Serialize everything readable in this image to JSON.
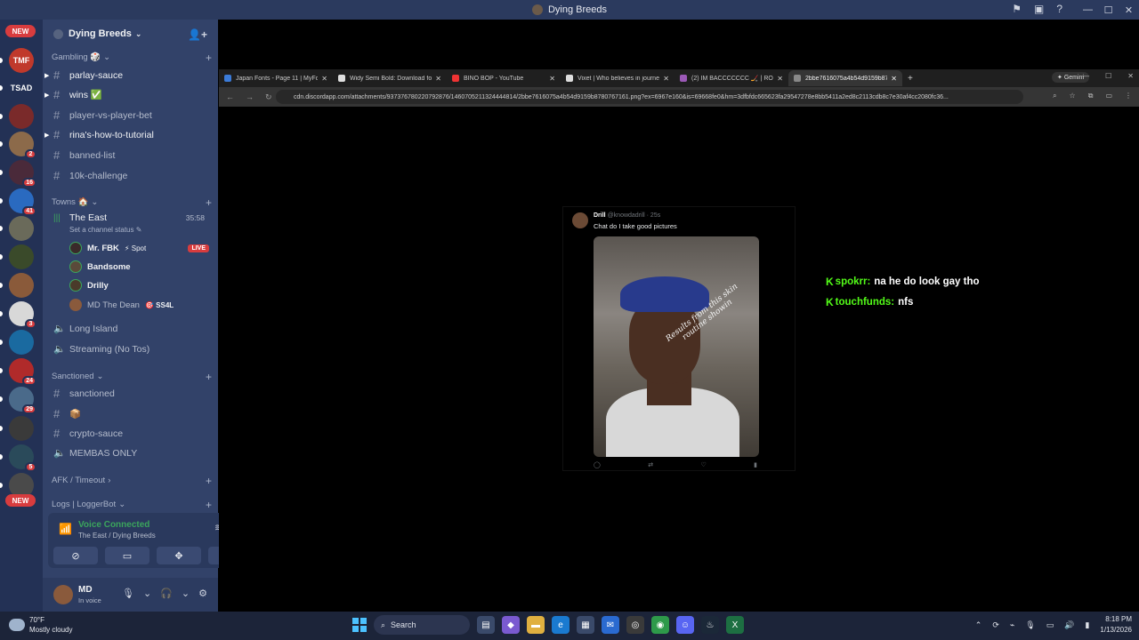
{
  "window": {
    "title": "Dying Breeds"
  },
  "server": {
    "name": "Dying Breeds"
  },
  "guilds": [
    {
      "label": "NEW",
      "kind": "pill"
    },
    {
      "label": "TMF",
      "color": "#c0392b"
    },
    {
      "label": "TSAD",
      "color": "#233155"
    },
    {
      "label": "",
      "color": "#7a2a2a"
    },
    {
      "label": "",
      "color": "#8c6a4a",
      "badge": "2"
    },
    {
      "label": "",
      "color": "#4a2a3a",
      "badge": "16"
    },
    {
      "label": "",
      "color": "#2a6ac0",
      "badge": "41"
    },
    {
      "label": "",
      "color": "#6a6a5a"
    },
    {
      "label": "",
      "color": "#3a4a2a"
    },
    {
      "label": "",
      "color": "#8a5a3a"
    },
    {
      "label": "",
      "color": "#d8d8d8",
      "badge": "3"
    },
    {
      "label": "",
      "color": "#1a6aa0"
    },
    {
      "label": "",
      "color": "#b02a2a",
      "badge": "24"
    },
    {
      "label": "",
      "color": "#4a6a8a",
      "badge": "29"
    },
    {
      "label": "",
      "color": "#3a3a3a"
    },
    {
      "label": "",
      "color": "#2a4a5a",
      "badge": "5"
    },
    {
      "label": "",
      "color": "#4a4a4a"
    },
    {
      "label": "NEW",
      "kind": "pill"
    }
  ],
  "categories": {
    "gambling": "Gambling 🎲",
    "towns": "Towns 🏠",
    "sanctioned": "Sanctioned",
    "afk": "AFK / Timeout",
    "logs": "Logs | LoggerBot"
  },
  "channels": {
    "parlay": "parlay-sauce",
    "wins": "wins ✅",
    "pvp": "player-vs-player-bet",
    "tutorial": "rina's-how-to-tutorial",
    "banned": "banned-list",
    "challenge": "10k-challenge",
    "east": "The East",
    "east_time": "35:58",
    "east_status": "Set a channel status ✎",
    "long_island": "Long Island",
    "streaming": "Streaming (No Tos)",
    "sanctioned": "sanctioned",
    "box": "📦",
    "crypto": "crypto-sauce",
    "membas": "MEMBAS ONLY"
  },
  "voice_users": [
    {
      "name": "Mr. FBK",
      "extra": "⚡ Spot",
      "live": "LIVE",
      "color": "#3a2a2a"
    },
    {
      "name": "Bandsome",
      "extra": "",
      "live": "",
      "color": "#5a4a3a"
    },
    {
      "name": "Drilly",
      "extra": "",
      "live": "",
      "color": "#4a3a2a"
    },
    {
      "name": "MD The Dean",
      "extra": "🎯 SS4L",
      "live": "",
      "color": "#8a5a3c"
    }
  ],
  "voice_panel": {
    "title": "Voice Connected",
    "subtitle": "The East / Dying Breeds"
  },
  "user": {
    "name": "MD",
    "status": "In voice"
  },
  "browser": {
    "tabs": [
      {
        "title": "Japan Fonts - Page 11 | MyFonts",
        "color": "#3b7bd8"
      },
      {
        "title": "Widy Semi Bold: Download for",
        "color": "#e0e0e0"
      },
      {
        "title": "BINO BOP - YouTube",
        "color": "#e33"
      },
      {
        "title": "Vixet | Who believes in journey",
        "color": "#ddd"
      },
      {
        "title": "(2) IM BACCCCCCC 🏒 | ROAD",
        "color": "#9b59b6"
      },
      {
        "title": "2bbe7616075a4b54d9159b878",
        "color": "#888",
        "active": true
      }
    ],
    "gemini": "✦ Gemini",
    "url": "cdn.discordapp.com/attachments/937376780220792876/1460705211324444814/2bbe7616075a4b54d9159b8780767161.png?ex=6967e160&is=69668fe0&hm=3dfbfdc665623fa29547278e8bb5411a2ed8c2113cdb8c7e30af4cc2080fc36..."
  },
  "tweet": {
    "name": "Drill",
    "handle": "@knowdadrill · 25s",
    "text": "Chat do I take good pictures",
    "caption": "Results from this skin routine showin"
  },
  "chat": [
    {
      "user": "spokrr:",
      "message": "na he do look gay tho"
    },
    {
      "user": "touchfunds:",
      "message": "nfs"
    }
  ],
  "taskbar": {
    "temp": "70°F",
    "condition": "Mostly cloudy",
    "search": "Search",
    "time": "8:18 PM",
    "date": "1/13/2026"
  },
  "colors": {
    "accent": "#53fc18",
    "discord_bg": "#324269",
    "live_red": "#d83c3e"
  }
}
